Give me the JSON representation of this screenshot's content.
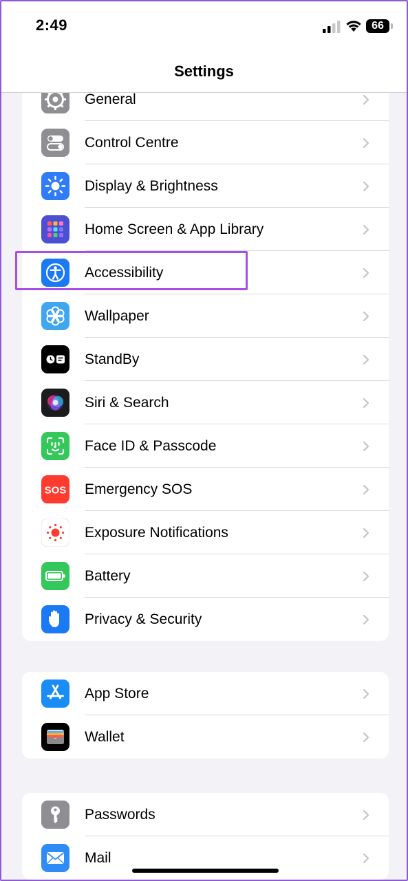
{
  "status_bar": {
    "time": "2:49",
    "battery": "66"
  },
  "nav": {
    "title": "Settings"
  },
  "groups": [
    [
      {
        "id": "general",
        "label": "General",
        "icon": "gear-icon",
        "color": "#8e8e93"
      },
      {
        "id": "control-centre",
        "label": "Control Centre",
        "icon": "toggles-icon",
        "color": "#8e8e93"
      },
      {
        "id": "display-brightness",
        "label": "Display & Brightness",
        "icon": "sun-icon",
        "color": "#2f7cf6"
      },
      {
        "id": "home-screen",
        "label": "Home Screen & App Library",
        "icon": "app-grid-icon",
        "color": "#4b4fd1"
      },
      {
        "id": "accessibility",
        "label": "Accessibility",
        "icon": "accessibility-icon",
        "color": "#1a79f3"
      },
      {
        "id": "wallpaper",
        "label": "Wallpaper",
        "icon": "flower-icon",
        "color": "#40a6ee"
      },
      {
        "id": "standby",
        "label": "StandBy",
        "icon": "standby-icon",
        "color": "#000000"
      },
      {
        "id": "siri-search",
        "label": "Siri & Search",
        "icon": "siri-icon",
        "color": "#1c1c1e"
      },
      {
        "id": "face-id",
        "label": "Face ID & Passcode",
        "icon": "face-id-icon",
        "color": "#34c759"
      },
      {
        "id": "emergency-sos",
        "label": "Emergency SOS",
        "icon": "sos-icon",
        "color": "#ff3b30"
      },
      {
        "id": "exposure",
        "label": "Exposure Notifications",
        "icon": "exposure-icon",
        "color": "#ffffff"
      },
      {
        "id": "battery",
        "label": "Battery",
        "icon": "battery-icon",
        "color": "#34c759"
      },
      {
        "id": "privacy",
        "label": "Privacy & Security",
        "icon": "hand-icon",
        "color": "#1a79f3"
      }
    ],
    [
      {
        "id": "app-store",
        "label": "App Store",
        "icon": "app-store-icon",
        "color": "#1a8cf5"
      },
      {
        "id": "wallet",
        "label": "Wallet",
        "icon": "wallet-icon",
        "color": "#000000"
      }
    ],
    [
      {
        "id": "passwords",
        "label": "Passwords",
        "icon": "key-icon",
        "color": "#8e8e93"
      },
      {
        "id": "mail",
        "label": "Mail",
        "icon": "mail-icon",
        "color": "#2f8cf5"
      }
    ]
  ],
  "highlight": {
    "target": "accessibility",
    "color": "#a74ee6"
  }
}
